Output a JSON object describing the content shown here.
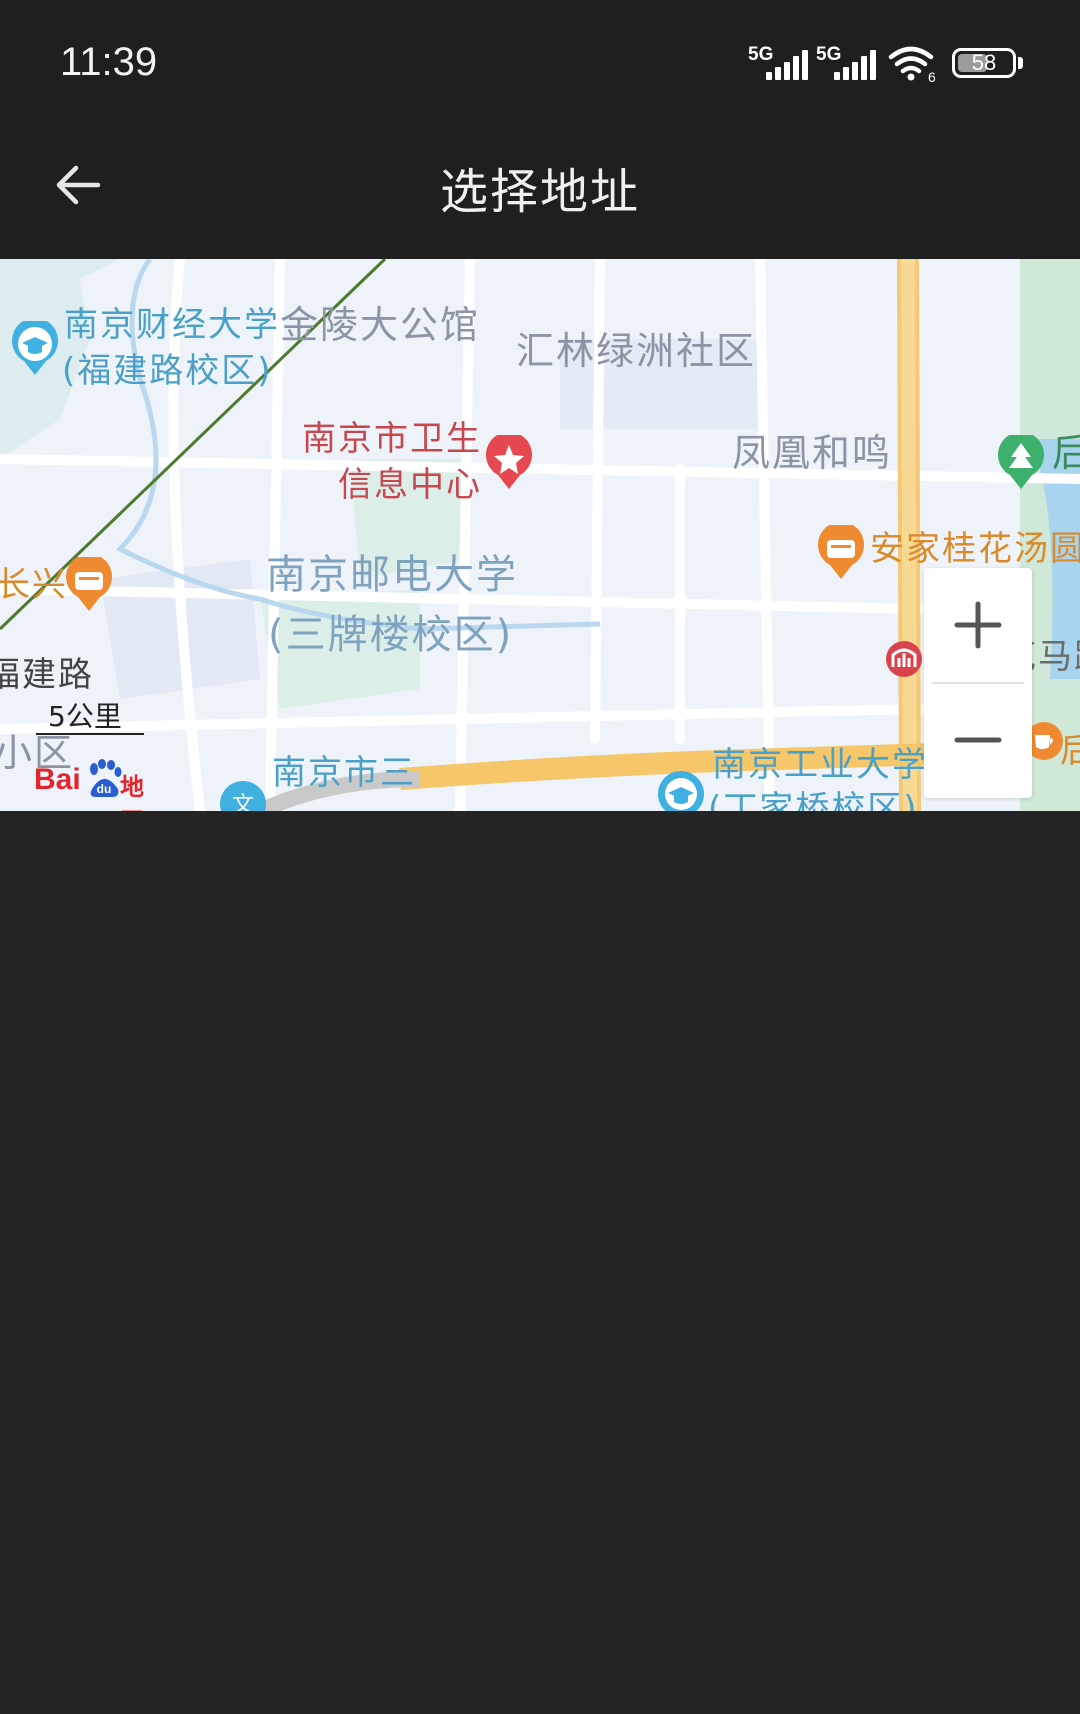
{
  "status_bar": {
    "time": "11:39",
    "network_1": "5G",
    "network_2": "5G",
    "wifi_badge": "6",
    "battery": "58"
  },
  "header": {
    "title": "选择地址"
  },
  "map": {
    "labels": {
      "nufe_1": "南京财经大学",
      "nufe_2": "(福建路校区)",
      "jinling": "金陵大公馆",
      "huilin": "汇林绿洲社区",
      "health_1": "南京市卫生",
      "health_2": "信息中心",
      "fenghuang": "凤凰和鸣",
      "hou_1": "后",
      "anjia": "安家桂花汤圆",
      "changxing": "长兴",
      "njupt_1": "南京邮电大学",
      "njupt_2": "(三牌楼校区)",
      "fujian_road": "福建路",
      "xiaoqu": "小区",
      "nanjing_san": "南京市三",
      "njtech_1": "南京工业大学",
      "njtech_2": "(丁家桥校区)",
      "metro": "新模范马路",
      "hou_2": "后"
    },
    "scale_label": "5公里",
    "logo_text": "Bai",
    "logo_text_2": "地图",
    "zoom_in": "+",
    "zoom_out": "—"
  }
}
